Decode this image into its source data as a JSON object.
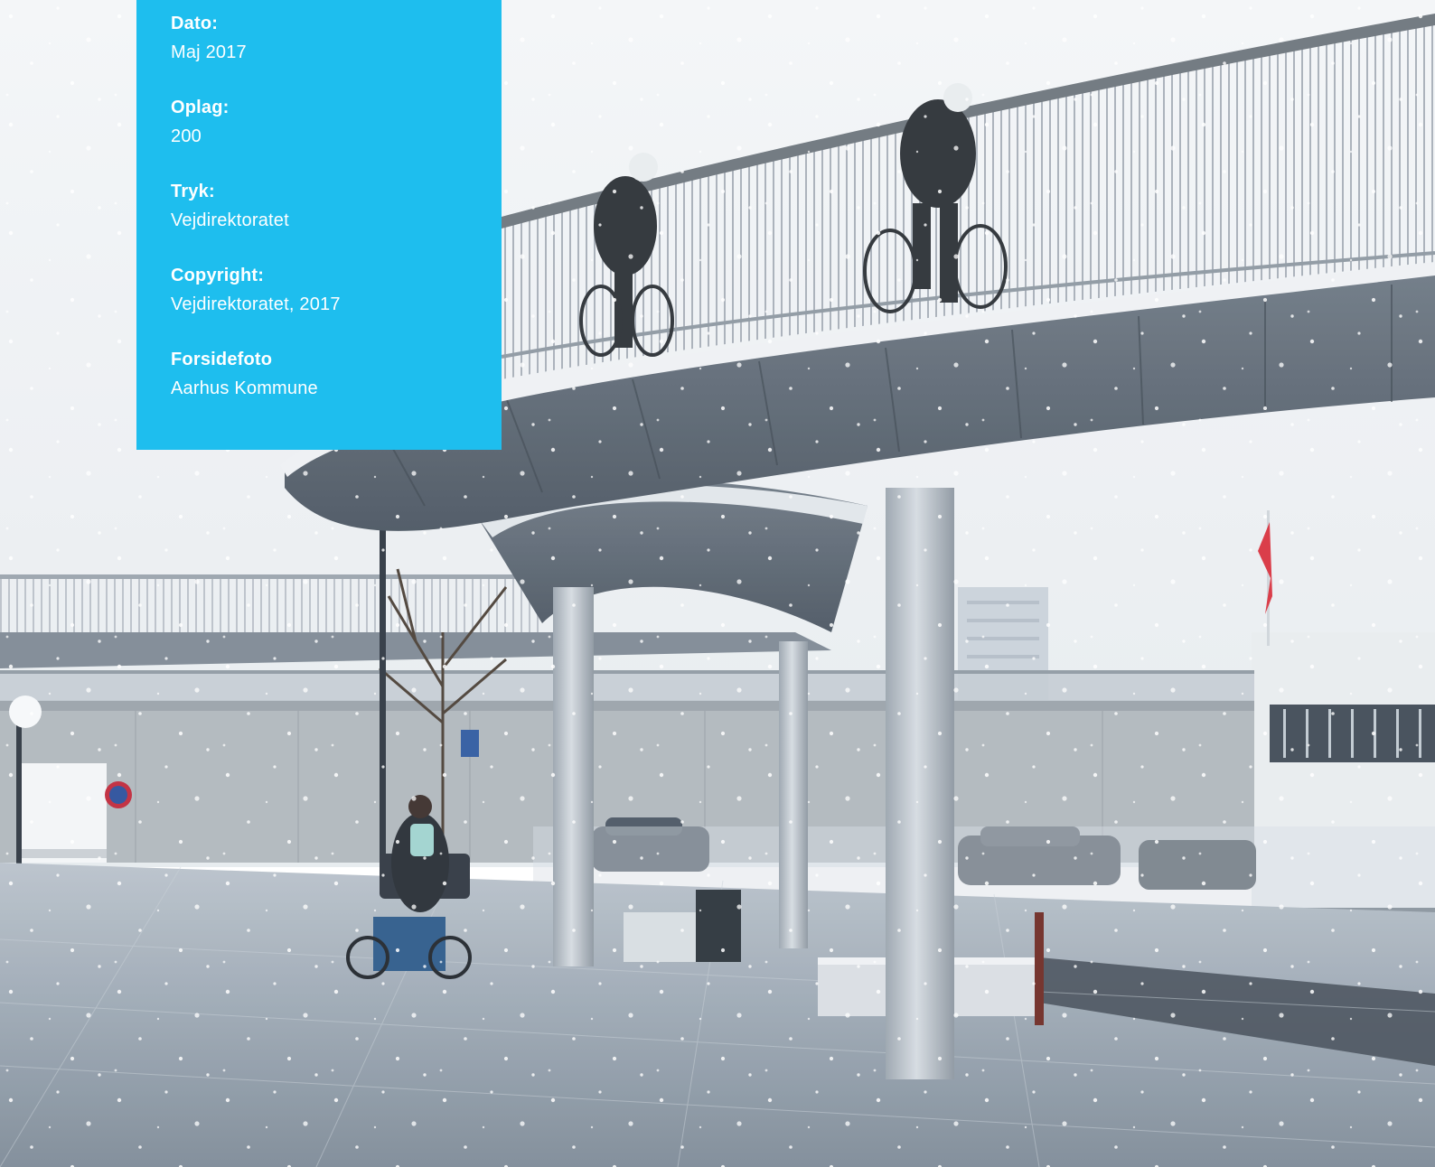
{
  "colophon": {
    "items": [
      {
        "label": "Dato:",
        "value": "Maj 2017"
      },
      {
        "label": "Oplag:",
        "value": "200"
      },
      {
        "label": "Tryk:",
        "value": "Vejdirektoratet"
      },
      {
        "label": "Copyright:",
        "value": "Vejdirektoratet, 2017"
      },
      {
        "label": "Forsidefoto",
        "value": "Aarhus Kommune"
      }
    ]
  },
  "photo": {
    "subject": "snowy-elevated-bicycle-bridge-photo"
  },
  "colors": {
    "panel": "#1ebeee",
    "panel_text": "#ffffff",
    "sky": "#eef2f5",
    "pavement": "#aab4bf",
    "steel": "#c6ced6",
    "deck_underside": "#5a6470"
  }
}
